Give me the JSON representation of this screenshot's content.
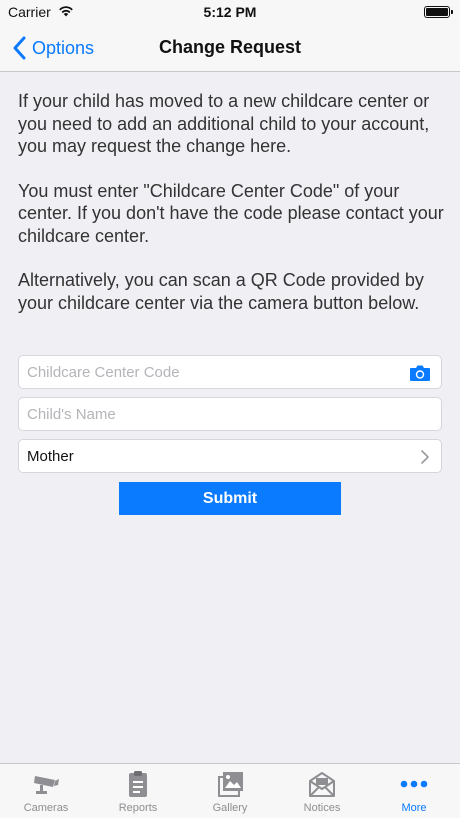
{
  "status": {
    "carrier": "Carrier",
    "time": "5:12 PM"
  },
  "nav": {
    "back_label": "Options",
    "title": "Change Request"
  },
  "paragraphs": [
    "If your child has moved to a new childcare center or you need to add an additional child to your account, you may request the change here.",
    "You must enter \"Childcare Center Code\" of your center.  If you don't have the code please contact your childcare center.",
    "Alternatively, you can scan a QR Code provided by your childcare center via the camera button below."
  ],
  "form": {
    "code_placeholder": "Childcare Center Code",
    "name_placeholder": "Child's Name",
    "relation_value": "Mother",
    "submit_label": "Submit"
  },
  "tabs": [
    {
      "label": "Cameras",
      "icon": "camera-cctv-icon",
      "active": false
    },
    {
      "label": "Reports",
      "icon": "clipboard-icon",
      "active": false
    },
    {
      "label": "Gallery",
      "icon": "photos-icon",
      "active": false
    },
    {
      "label": "Notices",
      "icon": "envelope-icon",
      "active": false
    },
    {
      "label": "More",
      "icon": "more-dots-icon",
      "active": true
    }
  ],
  "colors": {
    "accent": "#0a7aff",
    "background": "#efeff4"
  }
}
